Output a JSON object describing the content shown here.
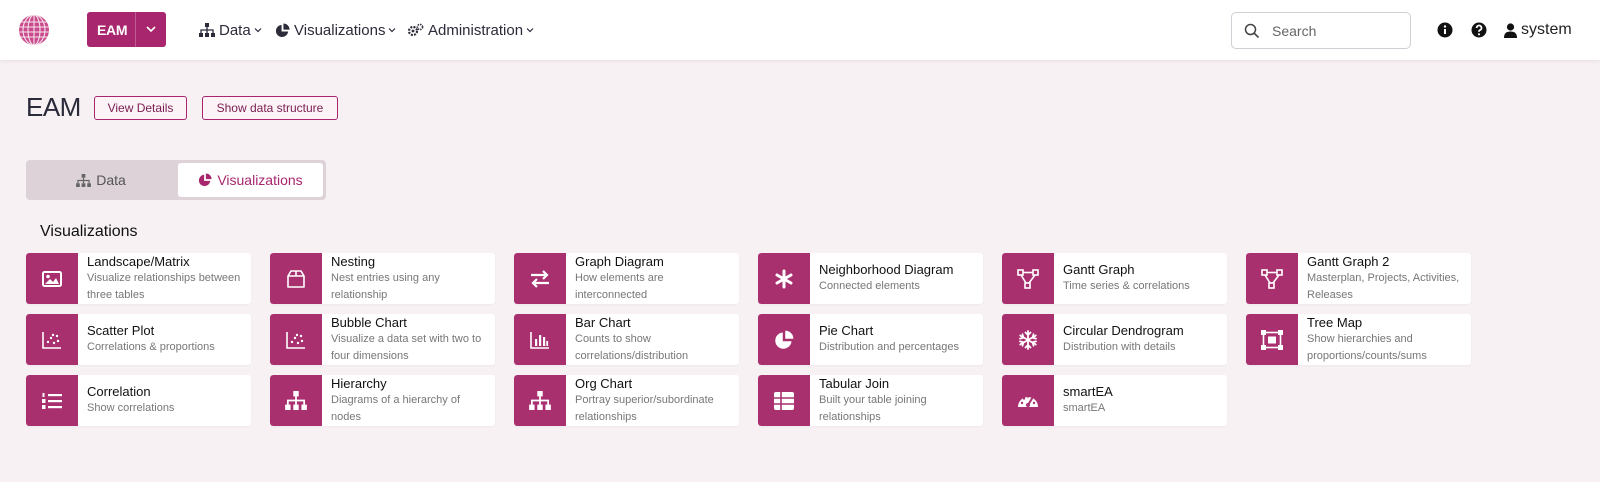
{
  "header": {
    "app_label": "EAM",
    "nav": [
      {
        "label": "Data",
        "icon": "sitemap-icon"
      },
      {
        "label": "Visualizations",
        "icon": "pie-chart-icon"
      },
      {
        "label": "Administration",
        "icon": "gears-icon"
      }
    ],
    "search_placeholder": "Search",
    "user": "system"
  },
  "page": {
    "title": "EAM",
    "view_details_label": "View Details",
    "show_structure_label": "Show data structure"
  },
  "tabs": [
    {
      "label": "Data",
      "active": false
    },
    {
      "label": "Visualizations",
      "active": true
    }
  ],
  "section_title": "Visualizations",
  "cards": [
    {
      "title": "Landscape/Matrix",
      "desc": "Visualize relationships between three tables",
      "icon": "image-icon"
    },
    {
      "title": "Nesting",
      "desc": "Nest entries using any relationship",
      "icon": "box-icon"
    },
    {
      "title": "Graph Diagram",
      "desc": "How elements are interconnected",
      "icon": "exchange-arrows-icon"
    },
    {
      "title": "Neighborhood Diagram",
      "desc": "Connected elements",
      "icon": "asterisk-icon"
    },
    {
      "title": "Gantt Graph",
      "desc": "Time series & correlations",
      "icon": "vector-nodes-icon"
    },
    {
      "title": "Gantt Graph 2",
      "desc": "Masterplan, Projects, Activities, Releases",
      "icon": "vector-nodes-icon"
    },
    {
      "title": "Scatter Plot",
      "desc": "Correlations & proportions",
      "icon": "scatter-chart-icon"
    },
    {
      "title": "Bubble Chart",
      "desc": "Visualize a data set with two to four dimensions",
      "icon": "scatter-chart-icon"
    },
    {
      "title": "Bar Chart",
      "desc": "Counts to show correlations/distribution",
      "icon": "bar-chart-icon"
    },
    {
      "title": "Pie Chart",
      "desc": "Distribution and percentages",
      "icon": "pie-chart-icon"
    },
    {
      "title": "Circular Dendrogram",
      "desc": "Distribution with details",
      "icon": "snowflake-icon"
    },
    {
      "title": "Tree Map",
      "desc": "Show hierarchies and proportions/counts/sums",
      "icon": "object-group-icon"
    },
    {
      "title": "Correlation",
      "desc": "Show correlations",
      "icon": "list-ordered-icon"
    },
    {
      "title": "Hierarchy",
      "desc": "Diagrams of a hierarchy of nodes",
      "icon": "sitemap-icon"
    },
    {
      "title": "Org Chart",
      "desc": "Portray superior/subordinate relationships",
      "icon": "sitemap-icon"
    },
    {
      "title": "Tabular Join",
      "desc": "Built your table joining relationships",
      "icon": "table-icon"
    },
    {
      "title": "smartEA",
      "desc": "smartEA",
      "icon": "gauge-icon"
    }
  ]
}
